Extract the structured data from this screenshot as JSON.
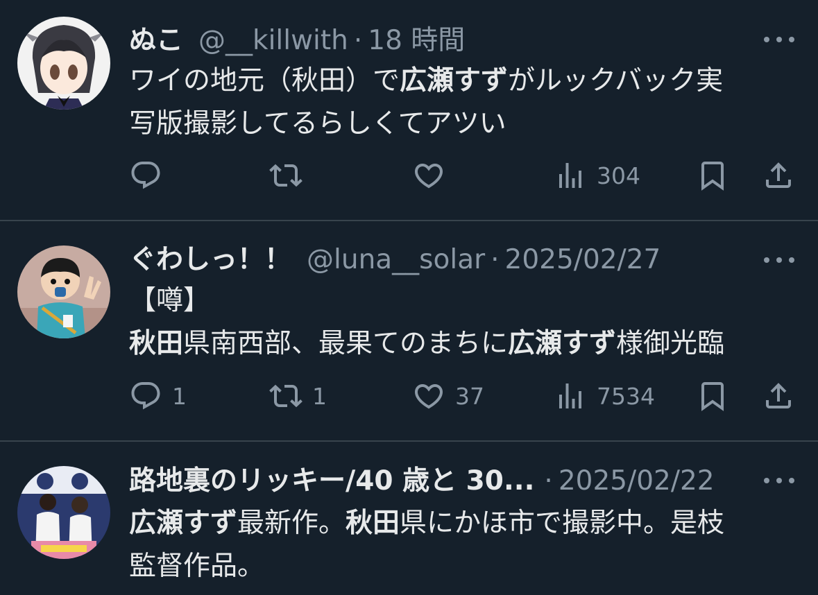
{
  "tweets": [
    {
      "name": "ぬこ",
      "handle": "@__killwith",
      "time": "18 時間",
      "text_lines": [
        [
          "ワイの地元（秋田）で",
          "広瀬すず",
          "がルックバック実"
        ],
        [
          "写版撮影してるらしくてアツい"
        ]
      ],
      "replies": "",
      "retweets": "",
      "likes": "",
      "views": "304"
    },
    {
      "name": "ぐわしっ！！",
      "handle": "@luna__solar",
      "time": "2025/02/27",
      "text_lines": [
        [
          "【噂】"
        ],
        [
          "秋田",
          "県南西部、最果てのまちに",
          "広瀬すず",
          "様御光臨"
        ]
      ],
      "replies": "1",
      "retweets": "1",
      "likes": "37",
      "views": "7534"
    },
    {
      "name": "路地裏のリッキー/40 歳と 30...",
      "handle": "",
      "time": "2025/02/22",
      "text_lines": [
        [
          "広瀬すず",
          "最新作。",
          "秋田",
          "県にかほ市で撮影中。是枝"
        ],
        [
          "監督作品。"
        ]
      ]
    }
  ],
  "dot_separator": "·",
  "icons": [
    "reply-icon",
    "retweet-icon",
    "like-icon",
    "views-icon",
    "bookmark-icon",
    "share-icon",
    "more-icon"
  ],
  "colors": {
    "background": "#15202b",
    "text": "#e7e9ea",
    "muted": "#8b98a5",
    "divider": "#38444d"
  }
}
